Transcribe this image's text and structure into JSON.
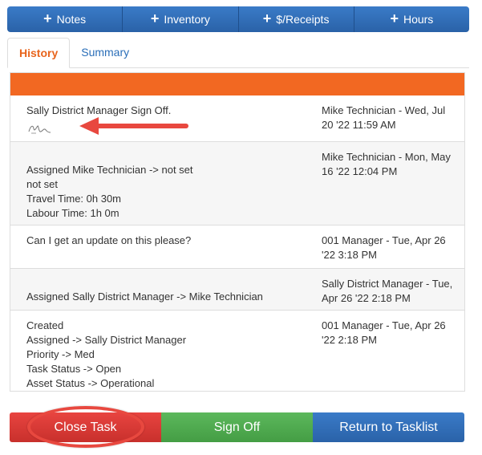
{
  "top_actions": [
    {
      "label": "Notes"
    },
    {
      "label": "Inventory"
    },
    {
      "label": "$/Receipts"
    },
    {
      "label": "Hours"
    }
  ],
  "tabs": [
    {
      "label": "History",
      "active": true
    },
    {
      "label": "Summary",
      "active": false
    }
  ],
  "history": [
    {
      "lines": [
        "Sally District Manager Sign Off."
      ],
      "author": "Mike Technician - Wed, Jul 20 '22 11:59 AM",
      "has_signature": true
    },
    {
      "lines": [
        "Assigned Mike Technician -> not set",
        "not set",
        "Travel Time: 0h 30m",
        "Labour Time: 1h 0m"
      ],
      "author": "Mike Technician - Mon, May 16 '22 12:04 PM"
    },
    {
      "lines": [
        "Can I get an update on this please?"
      ],
      "author": "001 Manager - Tue, Apr 26 '22 3:18 PM"
    },
    {
      "lines": [
        "Assigned Sally District Manager -> Mike Technician"
      ],
      "author": "Sally District Manager - Tue, Apr 26 '22 2:18 PM"
    },
    {
      "lines": [
        "Created",
        "Assigned -> Sally District Manager",
        "Priority -> Med",
        "Task Status -> Open",
        "Asset Status -> Operational"
      ],
      "author": "001 Manager - Tue, Apr 26 '22 2:18 PM"
    }
  ],
  "bottom_actions": {
    "close": "Close Task",
    "sign_off": "Sign Off",
    "return": "Return to Tasklist"
  },
  "colors": {
    "header_orange": "#f26822",
    "primary_blue": "#2a62a8",
    "danger_red": "#d9534f",
    "success_green": "#5cb85c",
    "annotation_red": "#e8483f"
  },
  "icons": {
    "plus": "plus-icon",
    "signature": "signature-icon",
    "arrow": "annotation-arrow-icon"
  }
}
